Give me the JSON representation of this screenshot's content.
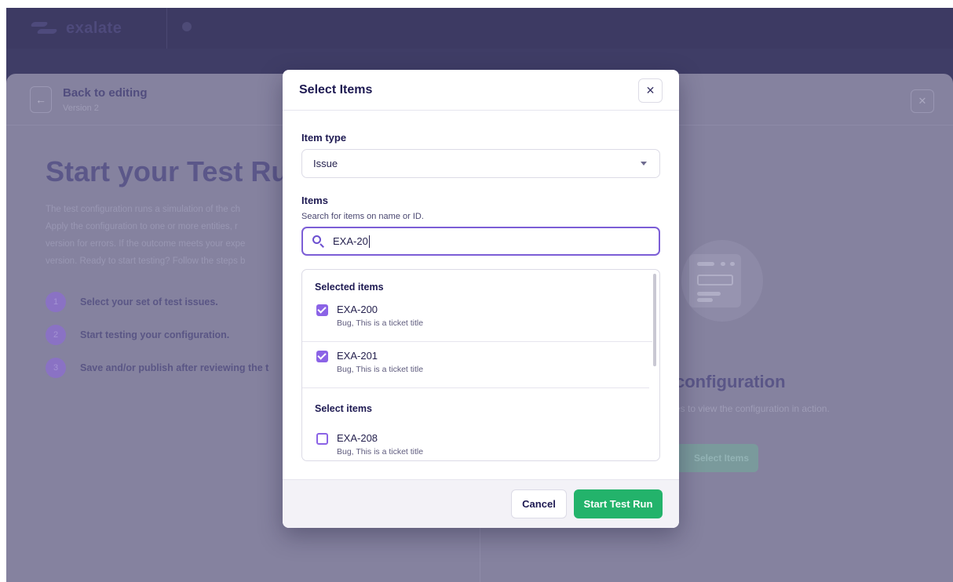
{
  "background": {
    "brand_name": "exalate",
    "back_title": "Back to editing",
    "back_subtitle": "Version 2",
    "page_title": "Start your Test Ru",
    "description_lines": [
      "The test configuration runs a simulation of the ch",
      "Apply the configuration to one or more entities, r",
      "version for errors. If the outcome meets your expe",
      "version. Ready to start testing? Follow the steps b"
    ],
    "steps": [
      {
        "num": "1",
        "text": "Select your set of test issues."
      },
      {
        "num": "2",
        "text": "Start testing your configuration."
      },
      {
        "num": "3",
        "text": "Save and/or publish after reviewing the t"
      }
    ],
    "right_title": "configuration",
    "right_desc": "es to view the configuration in action.",
    "right_button": "Select Items",
    "colors": {
      "frame": "#3f3d66",
      "panel": "#85829f"
    }
  },
  "modal": {
    "title": "Select Items",
    "close_icon": "close-icon",
    "item_type": {
      "label": "Item type",
      "selected": "Issue"
    },
    "items": {
      "label": "Items",
      "help": "Search for items on name or ID.",
      "search_value": "EXA-20",
      "search_icon": "search-icon"
    },
    "selected_section_label": "Selected items",
    "selected_items": [
      {
        "id": "EXA-200",
        "desc": "Bug, This is a ticket title",
        "checked": true
      },
      {
        "id": "EXA-201",
        "desc": "Bug, This is a ticket title",
        "checked": true
      }
    ],
    "select_section_label": "Select items",
    "available_items": [
      {
        "id": "EXA-208",
        "desc": "Bug, This is a ticket title",
        "checked": false
      }
    ],
    "footer": {
      "cancel_label": "Cancel",
      "start_label": "Start Test Run"
    },
    "colors": {
      "accent": "#8b63e6",
      "primary_button": "#23b36b",
      "title": "#1e1a52"
    }
  }
}
